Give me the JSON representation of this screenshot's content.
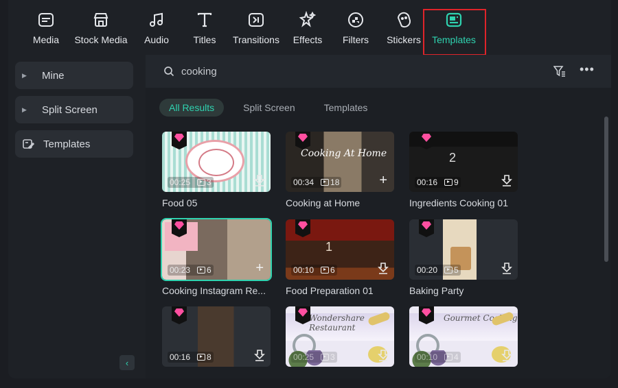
{
  "toolbar": {
    "items": [
      {
        "label": "Media",
        "icon": "media-icon"
      },
      {
        "label": "Stock Media",
        "icon": "stock-media-icon"
      },
      {
        "label": "Audio",
        "icon": "music-note-icon"
      },
      {
        "label": "Titles",
        "icon": "titles-icon"
      },
      {
        "label": "Transitions",
        "icon": "transitions-icon"
      },
      {
        "label": "Effects",
        "icon": "effects-icon"
      },
      {
        "label": "Filters",
        "icon": "filters-icon"
      },
      {
        "label": "Stickers",
        "icon": "stickers-icon"
      },
      {
        "label": "Templates",
        "icon": "templates-icon"
      }
    ],
    "active": "Templates",
    "accent_color": "#2fd3b0",
    "highlight_color": "#e0242a"
  },
  "sidebar": {
    "items": [
      {
        "label": "Mine"
      },
      {
        "label": "Split Screen"
      },
      {
        "label": "Templates"
      }
    ]
  },
  "search": {
    "value": "cooking"
  },
  "tabs": [
    {
      "label": "All Results"
    },
    {
      "label": "Split Screen"
    },
    {
      "label": "Templates"
    }
  ],
  "cards": [
    {
      "title": "Food 05",
      "duration": "00:25",
      "clips": "3",
      "action": "download"
    },
    {
      "title": "Cooking at Home",
      "duration": "00:34",
      "clips": "18",
      "action": "add",
      "thumb_text": "Cooking At Home"
    },
    {
      "title": "Ingredients Cooking 01",
      "duration": "00:16",
      "clips": "9",
      "action": "download",
      "thumb_text": "2"
    },
    {
      "title": "Cooking Instagram Re...",
      "duration": "00:23",
      "clips": "6",
      "action": "add"
    },
    {
      "title": "Food Preparation 01",
      "duration": "00:10",
      "clips": "6",
      "action": "download",
      "thumb_text": "1"
    },
    {
      "title": "Baking Party",
      "duration": "00:20",
      "clips": "5",
      "action": "download"
    },
    {
      "title": "",
      "duration": "00:16",
      "clips": "8",
      "action": "download"
    },
    {
      "title": "",
      "duration": "00:25",
      "clips": "3",
      "action": "download",
      "thumb_text": "Wondershare Restaurant"
    },
    {
      "title": "",
      "duration": "00:10",
      "clips": "4",
      "action": "download",
      "thumb_text": "Gourmet Cooking"
    }
  ]
}
